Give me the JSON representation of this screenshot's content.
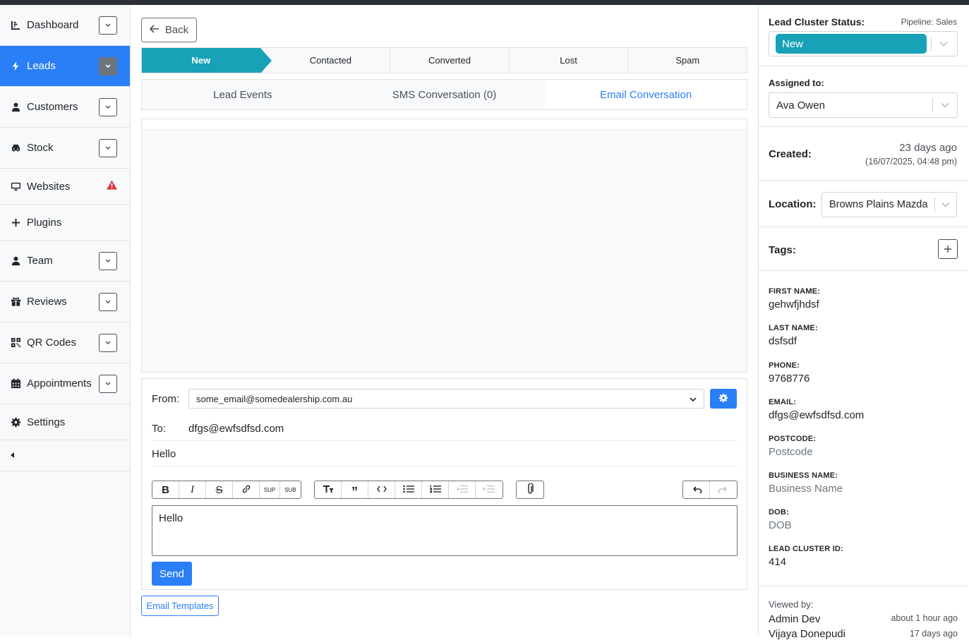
{
  "sidebar": {
    "items": [
      {
        "label": "Dashboard",
        "icon": "chart-line-icon"
      },
      {
        "label": "Leads",
        "icon": "bolt-icon"
      },
      {
        "label": "Customers",
        "icon": "user-icon"
      },
      {
        "label": "Stock",
        "icon": "car-icon"
      },
      {
        "label": "Websites",
        "icon": "monitor-icon"
      },
      {
        "label": "Plugins",
        "icon": "plus-icon"
      },
      {
        "label": "Team",
        "icon": "user-icon"
      },
      {
        "label": "Reviews",
        "icon": "gift-icon"
      },
      {
        "label": "QR Codes",
        "icon": "qrcode-icon"
      },
      {
        "label": "Appointments",
        "icon": "calendar-icon"
      },
      {
        "label": "Settings",
        "icon": "gear-icon"
      }
    ],
    "active": "Leads"
  },
  "header": {
    "back_label": "Back"
  },
  "pipeline": {
    "stages": [
      "New",
      "Contacted",
      "Converted",
      "Lost",
      "Spam"
    ],
    "active": "New"
  },
  "tabs": {
    "items": [
      "Lead Events",
      "SMS Conversation (0)",
      "Email Conversation"
    ],
    "active": "Email Conversation"
  },
  "compose": {
    "from_label": "From:",
    "from_value": "some_email@somedealership.com.au",
    "to_label": "To:",
    "to_value": "dfgs@ewfsdfsd.com",
    "subject": "Hello",
    "body": "Hello",
    "toolbar": {
      "sup": "SUP",
      "sub": "SUB"
    },
    "send_label": "Send"
  },
  "templates_label": "Email Templates",
  "right": {
    "status_label": "Lead Cluster Status:",
    "pipeline_label": "Pipeline: Sales",
    "status_value": "New",
    "assigned_label": "Assigned to:",
    "assigned_value": "Ava Owen",
    "created_label": "Created:",
    "created_relative": "23 days ago",
    "created_abs": "(16/07/2025, 04:48 pm)",
    "location_label": "Location:",
    "location_value": "Browns Plains Mazda",
    "tags_label": "Tags:",
    "fields": [
      {
        "label": "FIRST NAME:",
        "value": "gehwfjhdsf",
        "placeholder": false
      },
      {
        "label": "LAST NAME:",
        "value": "dsfsdf",
        "placeholder": false
      },
      {
        "label": "PHONE:",
        "value": "9768776",
        "placeholder": false
      },
      {
        "label": "EMAIL:",
        "value": "dfgs@ewfsdfsd.com",
        "placeholder": false
      },
      {
        "label": "POSTCODE:",
        "value": "Postcode",
        "placeholder": true
      },
      {
        "label": "BUSINESS NAME:",
        "value": "Business Name",
        "placeholder": true
      },
      {
        "label": "DOB:",
        "value": "DOB",
        "placeholder": true
      },
      {
        "label": "LEAD CLUSTER ID:",
        "value": "414",
        "placeholder": false
      }
    ],
    "viewed_label": "Viewed by:",
    "viewers": [
      {
        "name": "Admin Dev",
        "when": "about 1 hour ago"
      },
      {
        "name": "Vijaya Donepudi",
        "when": "17 days ago"
      }
    ]
  },
  "colors": {
    "accent": "#2a7ff6",
    "teal": "#17a2b8",
    "warning": "#dc3545"
  }
}
